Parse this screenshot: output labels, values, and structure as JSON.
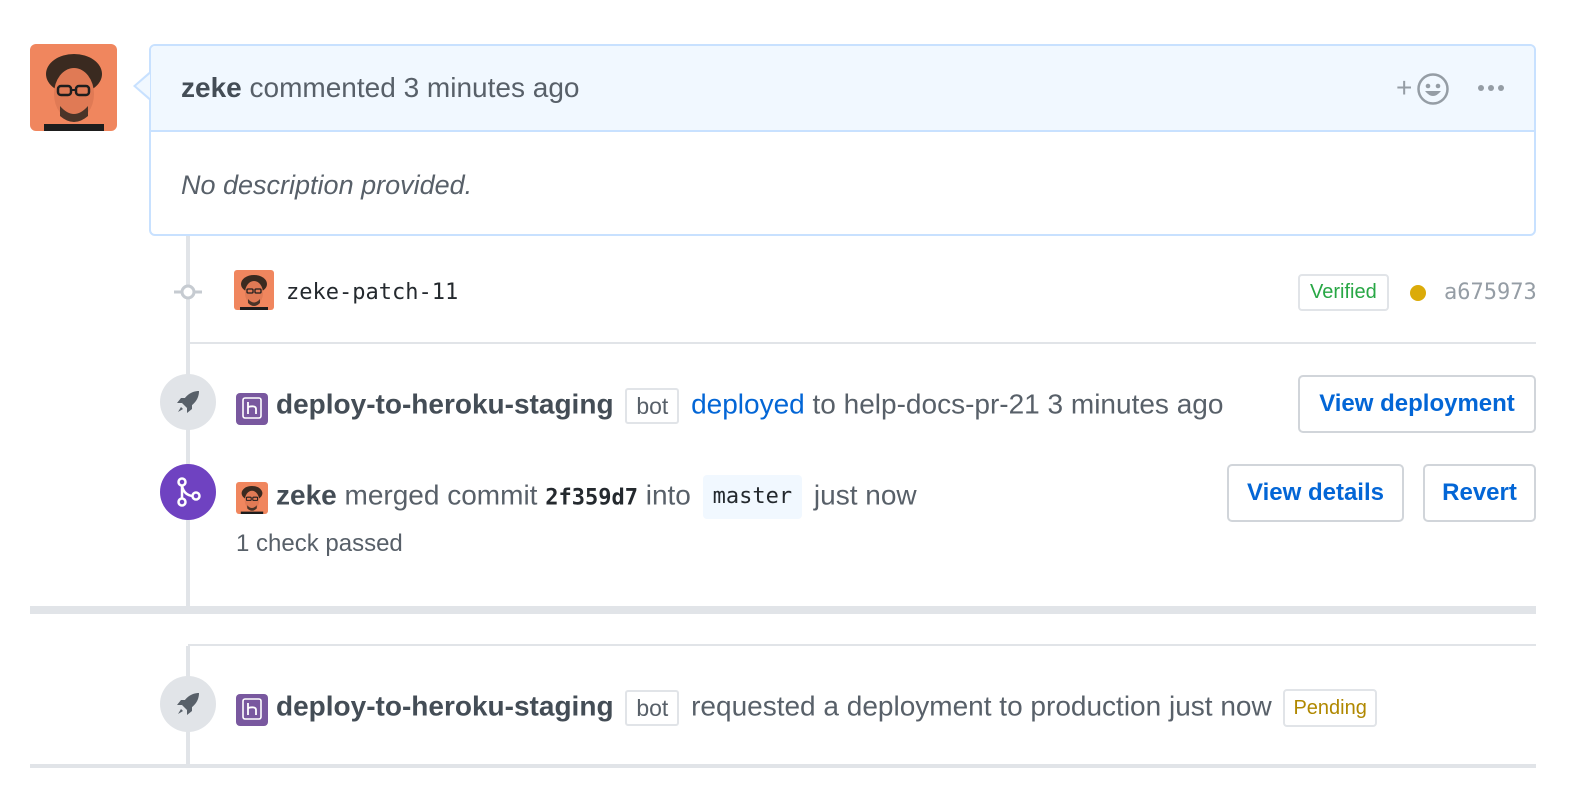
{
  "comment": {
    "author": "zeke",
    "action": "commented",
    "time": "3 minutes ago",
    "body": "No description provided.",
    "reaction_plus": "+"
  },
  "commit": {
    "message": "zeke-patch-11",
    "verified_label": "Verified",
    "status_color": "#dbab09",
    "sha": "a675973"
  },
  "deploy_event": {
    "actor": "deploy-to-heroku-staging",
    "bot_label": "bot",
    "action_link": "deployed",
    "rest": "to help-docs-pr-21 3 minutes ago",
    "button": "View deployment",
    "icon": "rocket-icon"
  },
  "merge_event": {
    "actor": "zeke",
    "action": "merged commit",
    "commit_sha": "2f359d7",
    "into": "into",
    "branch": "master",
    "time": "just now",
    "checks": "1 check passed",
    "view_details_button": "View details",
    "revert_button": "Revert",
    "icon": "git-merge-icon",
    "icon_color": "#6f42c1"
  },
  "deploy_request_event": {
    "actor": "deploy-to-heroku-staging",
    "bot_label": "bot",
    "text": "requested a deployment to production just now",
    "status_label": "Pending",
    "icon": "rocket-icon"
  },
  "colors": {
    "link": "#0366d6",
    "verified": "#28a745",
    "pending": "#b08800",
    "comment_header_bg": "#f1f8ff",
    "comment_border": "#c8e1ff"
  }
}
